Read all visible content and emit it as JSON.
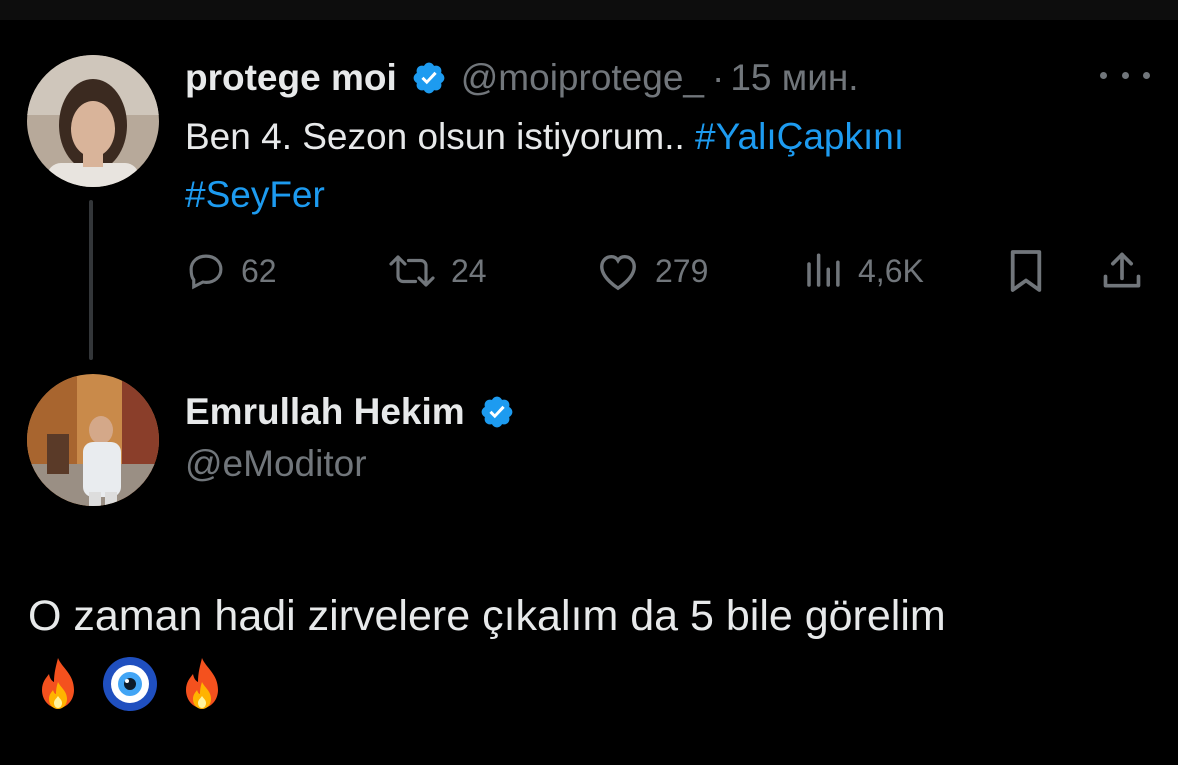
{
  "colors": {
    "background": "#000000",
    "text": "#e7e9ea",
    "muted": "#71767b",
    "accent": "#1d9bf0",
    "thread_line": "#333639"
  },
  "original_tweet": {
    "author_name": "protege moi",
    "verified": true,
    "handle": "@moiprotege_",
    "separator": "·",
    "time": "15 мин.",
    "text_plain": "Ben 4. Sezon olsun istiyorum..",
    "hashtag_1": "#YalıÇapkını",
    "hashtag_2": "#SeyFer",
    "avatar_icon": "user-avatar-photo",
    "more_icon": "more-horizontal-icon",
    "actions": {
      "reply": {
        "icon": "reply-icon",
        "count": "62"
      },
      "retweet": {
        "icon": "retweet-icon",
        "count": "24"
      },
      "like": {
        "icon": "heart-icon",
        "count": "279"
      },
      "views": {
        "icon": "views-chart-icon",
        "count": "4,6K"
      },
      "bookmark": {
        "icon": "bookmark-icon"
      },
      "share": {
        "icon": "share-icon"
      }
    }
  },
  "reply": {
    "author_name": "Emrullah Hekim",
    "verified": true,
    "handle": "@eModitor",
    "text": "O zaman hadi zirvelere çıkalım da 5 bile görelim",
    "emojis": [
      "fire-emoji",
      "nazar-evil-eye-emoji",
      "fire-emoji"
    ],
    "avatar_icon": "user-avatar-photo"
  }
}
